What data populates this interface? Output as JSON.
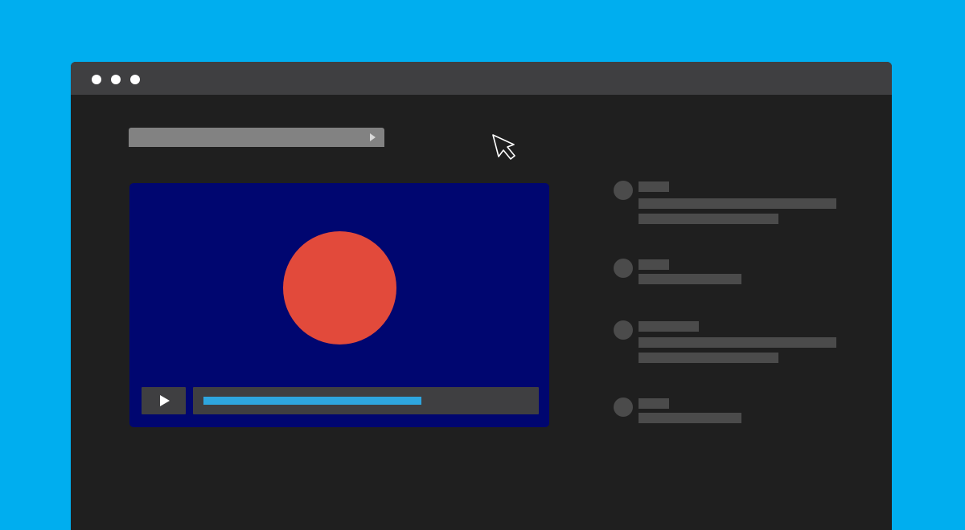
{
  "colors": {
    "desktop_background": "#00aeef",
    "window_background": "#1f1f1f",
    "title_bar": "#3f3f41",
    "window_controls": "#ffffff",
    "address_bar": "#828282",
    "video_background": "#000670",
    "video_shape": "#e24a3b",
    "player_controls": "#3f3f41",
    "progress_fill": "#2ea6df",
    "comment_placeholders": "#4b4b4b"
  },
  "icons": {
    "window_controls": [
      "window-dot-icon",
      "window-dot-icon",
      "window-dot-icon"
    ],
    "address_bar": "arrow-right-icon",
    "player": "play-icon",
    "cursor": "mouse-pointer-icon"
  },
  "video_player": {
    "progress_fraction": 0.67
  },
  "comments": [
    {
      "avatar": "avatar-placeholder",
      "text_lines": 2
    },
    {
      "avatar": "avatar-placeholder",
      "text_lines": 1
    },
    {
      "avatar": "avatar-placeholder",
      "text_lines": 2
    },
    {
      "avatar": "avatar-placeholder",
      "text_lines": 1
    }
  ]
}
